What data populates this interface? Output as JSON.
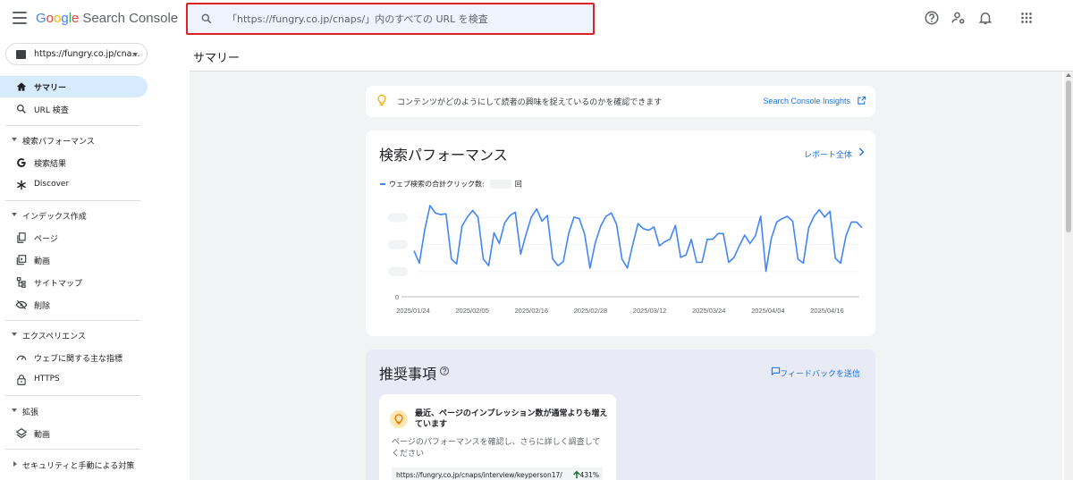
{
  "app": {
    "logo": {
      "google": "Google",
      "product": "Search Console"
    }
  },
  "search": {
    "placeholder": "「https://fungry.co.jp/cnaps/」内のすべての URL を検査"
  },
  "sidebar": {
    "property": "https://fungry.co.jp/cna...",
    "items": [
      {
        "label": "サマリー",
        "icon": "home-icon",
        "active": true
      },
      {
        "label": "URL 検査",
        "icon": "search-icon"
      }
    ],
    "sections": [
      {
        "label": "検索パフォーマンス",
        "items": [
          {
            "label": "検索結果",
            "icon": "google-g-icon"
          },
          {
            "label": "Discover",
            "icon": "asterisk-icon"
          }
        ]
      },
      {
        "label": "インデックス作成",
        "items": [
          {
            "label": "ページ",
            "icon": "pages-icon"
          },
          {
            "label": "動画",
            "icon": "video-icon"
          },
          {
            "label": "サイトマップ",
            "icon": "sitemap-icon"
          },
          {
            "label": "削除",
            "icon": "eye-off-icon"
          }
        ]
      },
      {
        "label": "エクスペリエンス",
        "items": [
          {
            "label": "ウェブに関する主な指標",
            "icon": "gauge-icon"
          },
          {
            "label": "HTTPS",
            "icon": "lock-icon"
          }
        ]
      },
      {
        "label": "拡張",
        "items": [
          {
            "label": "動画",
            "icon": "layers-icon"
          }
        ]
      },
      {
        "label": "セキュリティと手動による対策",
        "collapsed": true
      }
    ]
  },
  "main": {
    "title": "サマリー",
    "insight": {
      "text": "コンテンツがどのようにして読者の興味を捉えているのかを確認できます",
      "link": "Search Console Insights"
    },
    "performance": {
      "title": "検索パフォーマンス",
      "link": "レポート全体",
      "legend": "ウェブ検索の合計クリック数:",
      "legend_unit": "回"
    },
    "recommendations": {
      "title": "推奨事項",
      "feedback": "フィードバックを送信",
      "card": {
        "title": "最近、ページのインプレッション数が通常よりも増えています",
        "desc": "ページのパフォーマンスを確認し、さらに詳しく調査してください",
        "url": "https://fungry.co.jp/cnaps/interview/keyperson17/",
        "pct": "431%"
      }
    }
  },
  "colors": {
    "accent": "#1a73e8",
    "series": "#4285f4",
    "active_nav": "#d6ebfd",
    "highlight": "#e01f26"
  },
  "chart_data": {
    "type": "line",
    "x_ticks": [
      "2025/01/24",
      "2025/02/05",
      "2025/02/16",
      "2025/02/28",
      "2025/03/12",
      "2025/03/24",
      "2025/04/04",
      "2025/04/16"
    ],
    "y_ticks": [
      "0"
    ],
    "ylim": [
      0,
      100
    ],
    "series": [
      {
        "color": "#4285f4",
        "values": [
          45,
          30,
          70,
          100,
          91,
          89,
          90,
          35,
          29,
          75,
          86,
          94,
          86,
          35,
          27,
          67,
          54,
          79,
          88,
          92,
          41,
          65,
          86,
          96,
          81,
          88,
          35,
          27,
          32,
          66,
          86,
          84,
          65,
          24,
          55,
          75,
          87,
          91,
          77,
          35,
          24,
          52,
          78,
          72,
          70,
          74,
          51,
          56,
          59,
          76,
          37,
          40,
          59,
          31,
          31,
          59,
          59,
          66,
          66,
          31,
          37,
          51,
          64,
          54,
          63,
          87,
          20,
          60,
          80,
          84,
          87,
          81,
          35,
          30,
          73,
          87,
          95,
          86,
          93,
          36,
          30,
          63,
          80,
          80,
          73
        ],
        "note": "values are relative; y-axis scale labels hidden in screenshot"
      }
    ]
  }
}
